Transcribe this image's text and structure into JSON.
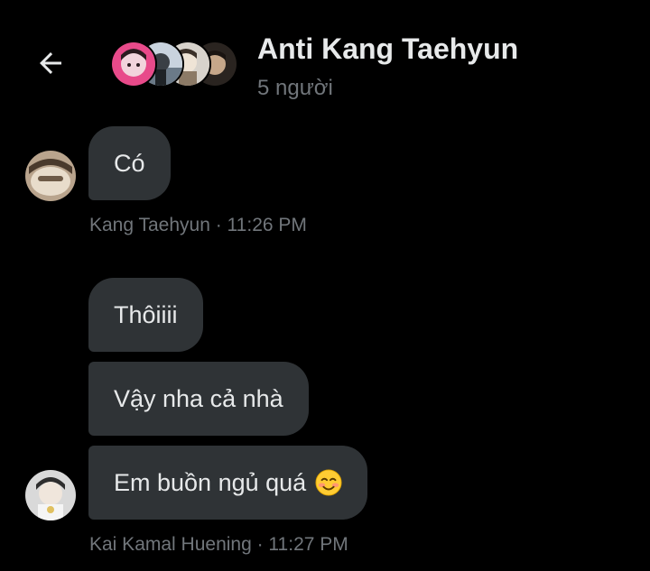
{
  "header": {
    "title": "Anti Kang Taehyun",
    "subtitle": "5 người",
    "back_icon": "arrow-left-icon"
  },
  "messages": [
    {
      "group": "Kang Taehyun",
      "items": [
        {
          "text": "Có"
        }
      ],
      "meta": "Kang Taehyun · 11:26 PM"
    },
    {
      "group": "Kai Kamal Huening",
      "items": [
        {
          "text": "Thôiiii"
        },
        {
          "text": "Vậy nha cả nhà"
        },
        {
          "text": "Em buồn ngủ quá",
          "emoji": "smiling-face-with-blush"
        }
      ],
      "meta": "Kai Kamal Huening · 11:27 PM"
    }
  ],
  "colors": {
    "background": "#000000",
    "bubble": "#2f3336",
    "text": "#e7e9ea",
    "muted": "#71767b"
  }
}
